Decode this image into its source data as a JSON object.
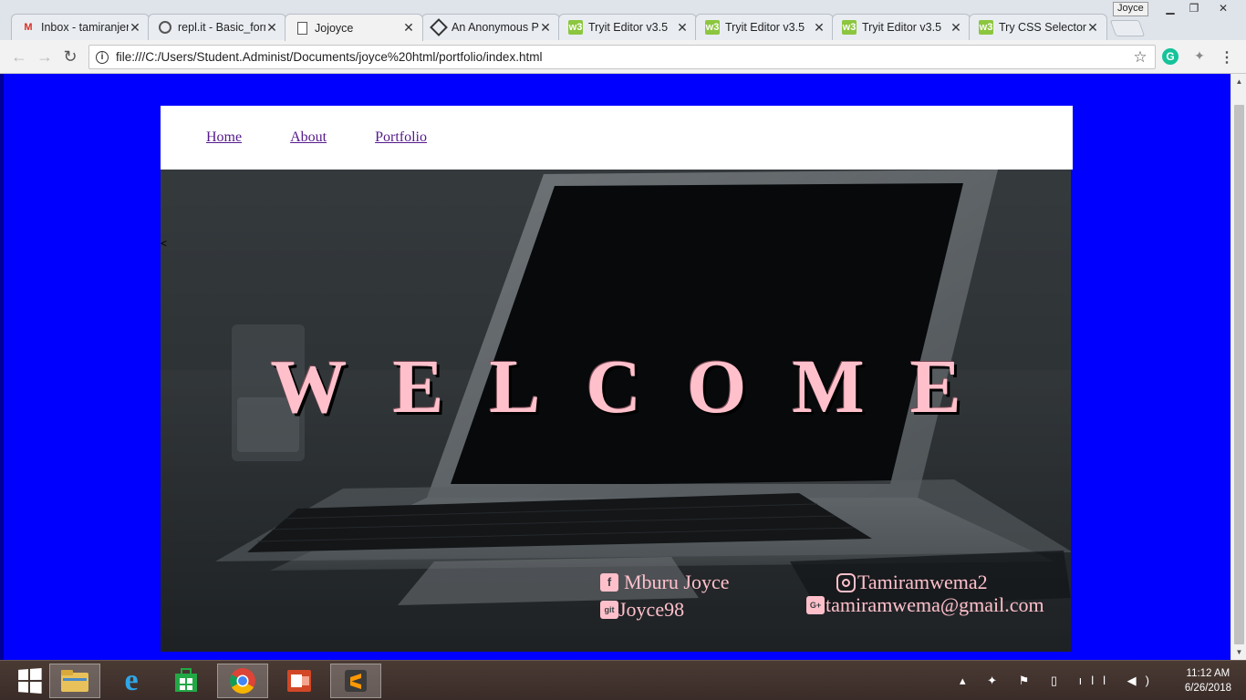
{
  "browser": {
    "profile_name": "Joyce",
    "tabs": [
      {
        "title": "Inbox - tamiranjeri",
        "icon": "gmail-icon"
      },
      {
        "title": "repl.it - Basic_form",
        "icon": "replit-icon"
      },
      {
        "title": "Jojoyce",
        "icon": "page-icon",
        "active": true
      },
      {
        "title": "An Anonymous Pen",
        "icon": "codepen-icon"
      },
      {
        "title": "Tryit Editor v3.5",
        "icon": "w3schools-icon"
      },
      {
        "title": "Tryit Editor v3.5",
        "icon": "w3schools-icon"
      },
      {
        "title": "Tryit Editor v3.5",
        "icon": "w3schools-icon"
      },
      {
        "title": "Try CSS Selector",
        "icon": "w3schools-icon"
      }
    ],
    "url": "file:///C:/Users/Student.Administ/Documents/joyce%20html/portfolio/index.html"
  },
  "site": {
    "nav": [
      "Home",
      "About",
      "Portfolio"
    ],
    "hero_marker": "<",
    "welcome": "WELCOME",
    "social": {
      "facebook": "Mburu Joyce",
      "github": "Joyce98",
      "instagram": "Tamiramwema2",
      "gplus": "tamiramwema@gmail.com"
    }
  },
  "taskbar": {
    "apps": [
      "file-explorer",
      "internet-explorer",
      "windows-store",
      "chrome",
      "outlook",
      "sublime-text"
    ],
    "time": "11:12 AM",
    "date": "6/26/2018"
  },
  "colors": {
    "page_bg": "#0000ff",
    "welcome_text": "#ffc0cb",
    "link": "#551a8b"
  }
}
